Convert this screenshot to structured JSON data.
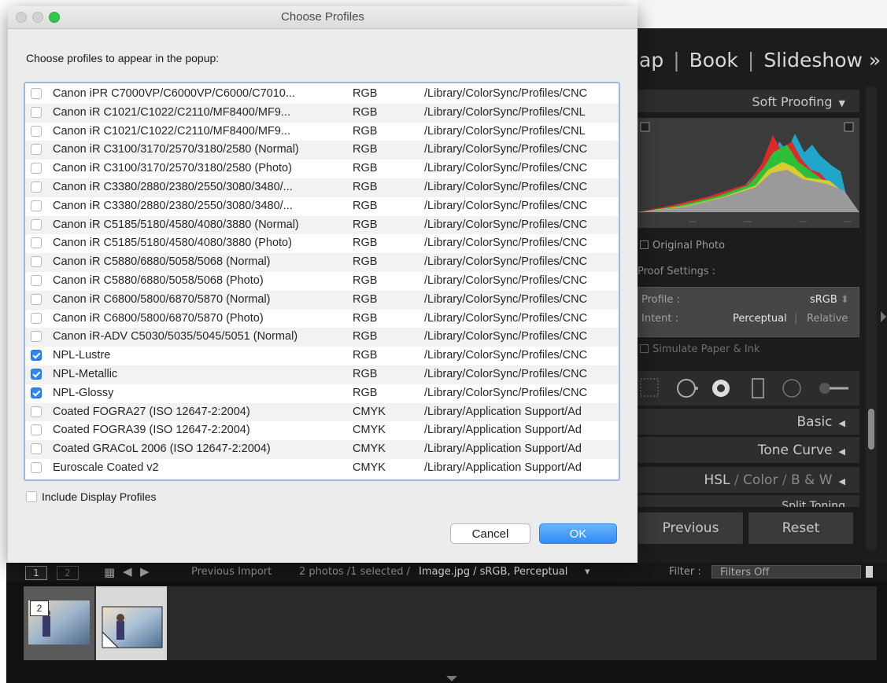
{
  "dialog": {
    "title": "Choose Profiles",
    "prompt": "Choose profiles to appear in the popup:",
    "include_display_label": "Include Display Profiles",
    "cancel_label": "Cancel",
    "ok_label": "OK",
    "profiles": [
      {
        "name": "Canon iPR C7000VP/C6000VP/C6000/C7010...",
        "space": "RGB",
        "path": "/Library/ColorSync/Profiles/CNC",
        "checked": false
      },
      {
        "name": "Canon iR C1021/C1022/C2110/MF8400/MF9...",
        "space": "RGB",
        "path": "/Library/ColorSync/Profiles/CNL",
        "checked": false
      },
      {
        "name": "Canon iR C1021/C1022/C2110/MF8400/MF9...",
        "space": "RGB",
        "path": "/Library/ColorSync/Profiles/CNL",
        "checked": false
      },
      {
        "name": "Canon iR C3100/3170/2570/3180/2580 (Normal)",
        "space": "RGB",
        "path": "/Library/ColorSync/Profiles/CNC",
        "checked": false
      },
      {
        "name": "Canon iR C3100/3170/2570/3180/2580 (Photo)",
        "space": "RGB",
        "path": "/Library/ColorSync/Profiles/CNC",
        "checked": false
      },
      {
        "name": "Canon iR C3380/2880/2380/2550/3080/3480/...",
        "space": "RGB",
        "path": "/Library/ColorSync/Profiles/CNC",
        "checked": false
      },
      {
        "name": "Canon iR C3380/2880/2380/2550/3080/3480/...",
        "space": "RGB",
        "path": "/Library/ColorSync/Profiles/CNC",
        "checked": false
      },
      {
        "name": "Canon iR C5185/5180/4580/4080/3880 (Normal)",
        "space": "RGB",
        "path": "/Library/ColorSync/Profiles/CNC",
        "checked": false
      },
      {
        "name": "Canon iR C5185/5180/4580/4080/3880 (Photo)",
        "space": "RGB",
        "path": "/Library/ColorSync/Profiles/CNC",
        "checked": false
      },
      {
        "name": "Canon iR C5880/6880/5058/5068 (Normal)",
        "space": "RGB",
        "path": "/Library/ColorSync/Profiles/CNC",
        "checked": false
      },
      {
        "name": "Canon iR C5880/6880/5058/5068 (Photo)",
        "space": "RGB",
        "path": "/Library/ColorSync/Profiles/CNC",
        "checked": false
      },
      {
        "name": "Canon iR C6800/5800/6870/5870 (Normal)",
        "space": "RGB",
        "path": "/Library/ColorSync/Profiles/CNC",
        "checked": false
      },
      {
        "name": "Canon iR C6800/5800/6870/5870 (Photo)",
        "space": "RGB",
        "path": "/Library/ColorSync/Profiles/CNC",
        "checked": false
      },
      {
        "name": "Canon iR-ADV C5030/5035/5045/5051 (Normal)",
        "space": "RGB",
        "path": "/Library/ColorSync/Profiles/CNC",
        "checked": false
      },
      {
        "name": "NPL-Lustre",
        "space": "RGB",
        "path": "/Library/ColorSync/Profiles/CNC",
        "checked": true
      },
      {
        "name": "NPL-Metallic",
        "space": "RGB",
        "path": "/Library/ColorSync/Profiles/CNC",
        "checked": true
      },
      {
        "name": "NPL-Glossy",
        "space": "RGB",
        "path": "/Library/ColorSync/Profiles/CNC",
        "checked": true
      },
      {
        "name": "Coated FOGRA27 (ISO 12647-2:2004)",
        "space": "CMYK",
        "path": "/Library/Application Support/Ad",
        "checked": false
      },
      {
        "name": "Coated FOGRA39 (ISO 12647-2:2004)",
        "space": "CMYK",
        "path": "/Library/Application Support/Ad",
        "checked": false
      },
      {
        "name": "Coated GRACoL 2006 (ISO 12647-2:2004)",
        "space": "CMYK",
        "path": "/Library/Application Support/Ad",
        "checked": false
      },
      {
        "name": "Euroscale Coated v2",
        "space": "CMYK",
        "path": "/Library/Application Support/Ad",
        "checked": false
      }
    ]
  },
  "lightroom": {
    "modules": {
      "map": "ap",
      "book": "Book",
      "slideshow": "Slideshow",
      "more": "»"
    },
    "soft_proofing": "Soft Proofing",
    "original_photo": "Original Photo",
    "proof_settings": "Proof Settings :",
    "profile_label": "Profile :",
    "profile_value": "sRGB",
    "intent_label": "Intent :",
    "intent_perceptual": "Perceptual",
    "intent_relative": "Relative",
    "simulate": "Simulate Paper & Ink",
    "panels": {
      "basic": "Basic",
      "tone_curve": "Tone Curve",
      "hsl": "HSL",
      "color": "Color",
      "bw": "B & W",
      "split": "Split Toning"
    },
    "previous": "Previous",
    "reset": "Reset",
    "filmstrip": {
      "page1": "1",
      "page2": "2",
      "source": "Previous Import",
      "info": "2 photos /1 selected /",
      "file": "Image.jpg / sRGB, Perceptual",
      "filter_label": "Filter :",
      "filter_value": "Filters Off",
      "badge": "2"
    }
  },
  "colors": {
    "accent": "#2f85f1",
    "dialog_bg": "#ececec",
    "lr_panel": "#353535"
  }
}
